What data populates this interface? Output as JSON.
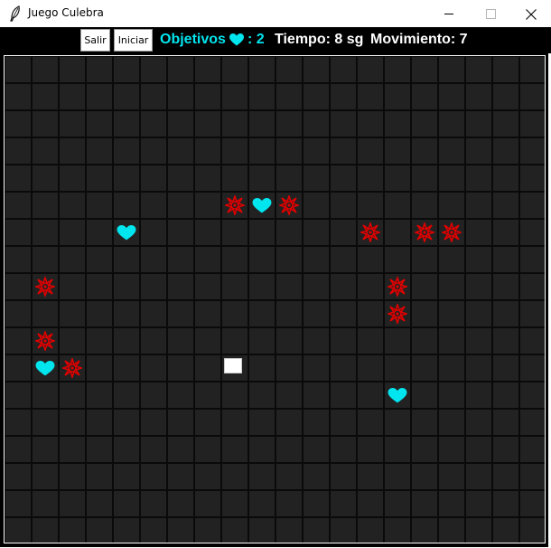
{
  "window": {
    "title": "Juego Culebra",
    "icon": "feather-icon",
    "controls": [
      "minimize-icon",
      "maximize-icon",
      "close-icon"
    ]
  },
  "toolbar": {
    "exit_label": "Salir",
    "start_label": "Iniciar",
    "objectives_label": "Objetivos",
    "objectives_icon": "heart-icon",
    "objectives_value": ": 2",
    "time_text": "Tiempo: 8 sg",
    "moves_text": "Movimiento: 7"
  },
  "colors": {
    "accent": "#00e5ee",
    "hazard": "#e00000",
    "board": "#222222",
    "grid_line": "#0a0a0a",
    "toolbar_bg": "#000000",
    "text": "#ffffff"
  },
  "board": {
    "columns": 20,
    "rows": 18,
    "snake_head": {
      "col": 8,
      "row": 11
    },
    "hearts": [
      {
        "col": 9,
        "row": 5
      },
      {
        "col": 4,
        "row": 6
      },
      {
        "col": 1,
        "row": 11
      },
      {
        "col": 14,
        "row": 12
      }
    ],
    "hazards": [
      {
        "col": 8,
        "row": 5
      },
      {
        "col": 10,
        "row": 5
      },
      {
        "col": 13,
        "row": 6
      },
      {
        "col": 15,
        "row": 6
      },
      {
        "col": 16,
        "row": 6
      },
      {
        "col": 1,
        "row": 8
      },
      {
        "col": 14,
        "row": 8
      },
      {
        "col": 14,
        "row": 9
      },
      {
        "col": 1,
        "row": 10
      },
      {
        "col": 2,
        "row": 11
      }
    ]
  }
}
